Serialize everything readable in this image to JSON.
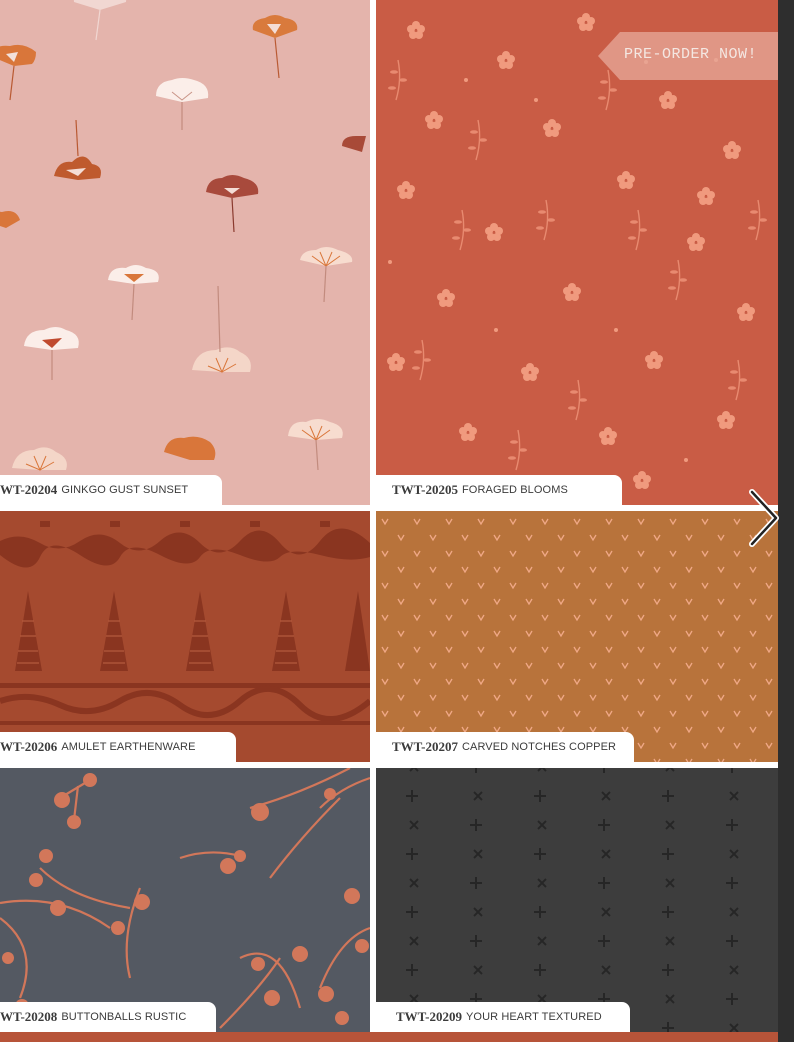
{
  "badge": {
    "text": "PRE-ORDER NOW!"
  },
  "products": [
    {
      "code": "WT-20204",
      "name": "GINKGO GUST SUNSET",
      "color": "#e4b4ac"
    },
    {
      "code": "TWT-20205",
      "name": "FORAGED BLOOMS",
      "color": "#c95c45"
    },
    {
      "code": "WT-20206",
      "name": "AMULET EARTHENWARE",
      "color": "#a54a2f"
    },
    {
      "code": "TWT-20207",
      "name": "CARVED NOTCHES COPPER",
      "color": "#b8733b"
    },
    {
      "code": "WT-20208",
      "name": "BUTTONBALLS RUSTIC",
      "color": "#545962"
    },
    {
      "code": "TWT-20209",
      "name": "YOUR HEART TEXTURED",
      "color": "#3d3d3d"
    }
  ],
  "icons": {
    "next": "chevron-right-icon"
  }
}
